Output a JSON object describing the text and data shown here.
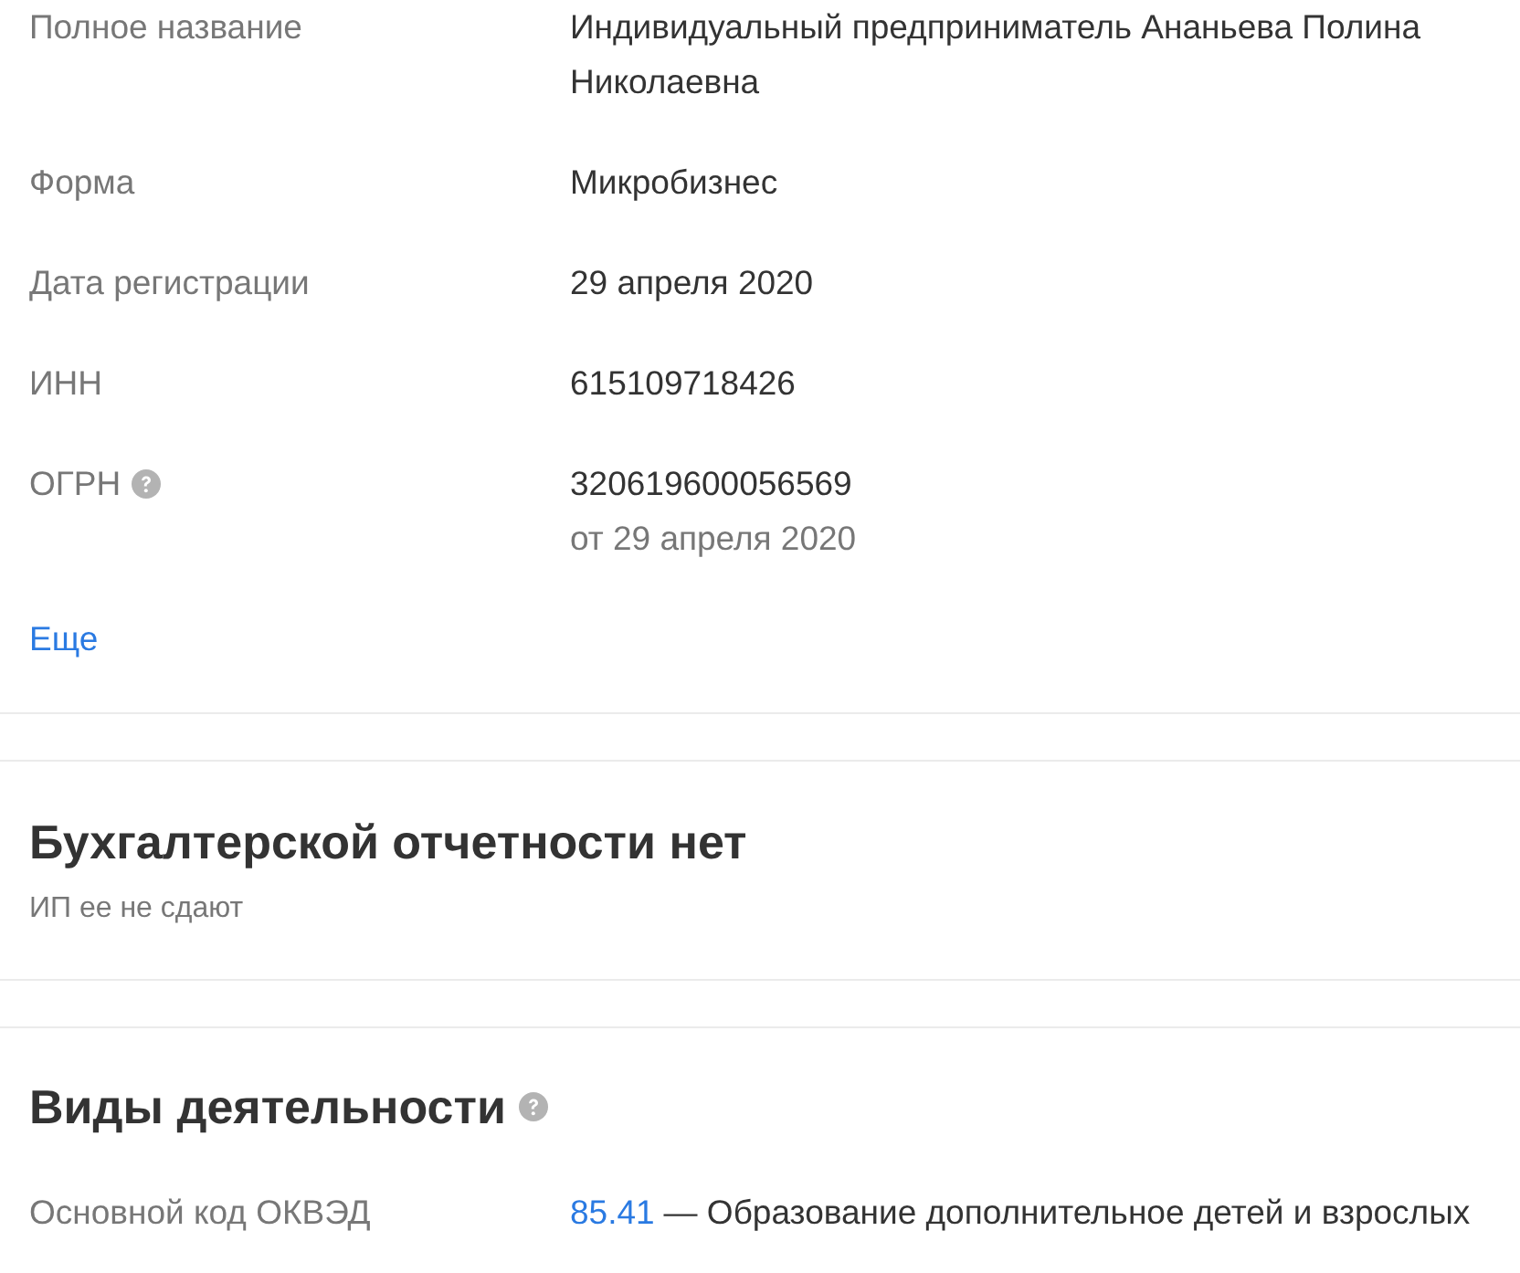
{
  "details": {
    "rows": [
      {
        "label": "Полное название",
        "help": false,
        "value": "Индивидуальный предприниматель Ананьева Полина Николаевна"
      },
      {
        "label": "Форма",
        "help": false,
        "value": "Микробизнес"
      },
      {
        "label": "Дата регистрации",
        "help": false,
        "value": "29 апреля 2020"
      },
      {
        "label": "ИНН",
        "help": false,
        "value": "615109718426"
      },
      {
        "label": "ОГРН",
        "help": true,
        "value": "320619600056569",
        "note": "от 29 апреля 2020"
      }
    ],
    "more_link": "Еще"
  },
  "accounting": {
    "title": "Бухгалтерской отчетности нет",
    "subtitle": "ИП ее не сдают"
  },
  "activities": {
    "title": "Виды деятельности",
    "help": true,
    "rows": [
      {
        "label": "Основной код ОКВЭД",
        "code": "85.41",
        "description": "— Образование дополнительное детей и взрослых"
      }
    ]
  }
}
